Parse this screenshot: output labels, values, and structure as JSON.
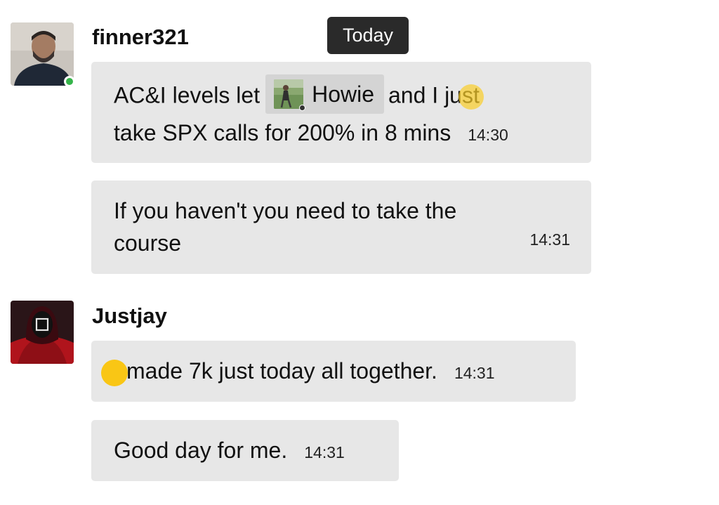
{
  "date_divider": "Today",
  "messages": [
    {
      "username": "finner321",
      "online": true,
      "bubbles": [
        {
          "text_before_mention": "AC&I levels let",
          "mention": "Howie",
          "text_after_mention": "and I just",
          "line2": "take SPX calls for 200% in 8 mins",
          "time": "14:30"
        },
        {
          "line1": "If you haven't you need to take the",
          "line2": "course",
          "time": "14:31"
        }
      ]
    },
    {
      "username": "Justjay",
      "bubbles": [
        {
          "text": "made 7k just today all together.",
          "time": "14:31"
        },
        {
          "text": "Good day for me.",
          "time": "14:31"
        }
      ]
    }
  ],
  "colors": {
    "bubble_bg": "#e7e7e7",
    "mention_bg": "#d4d4d4",
    "online_dot": "#35b44a",
    "date_pill_bg": "#2a2a2a",
    "touch_indicator": "#facc0a"
  }
}
